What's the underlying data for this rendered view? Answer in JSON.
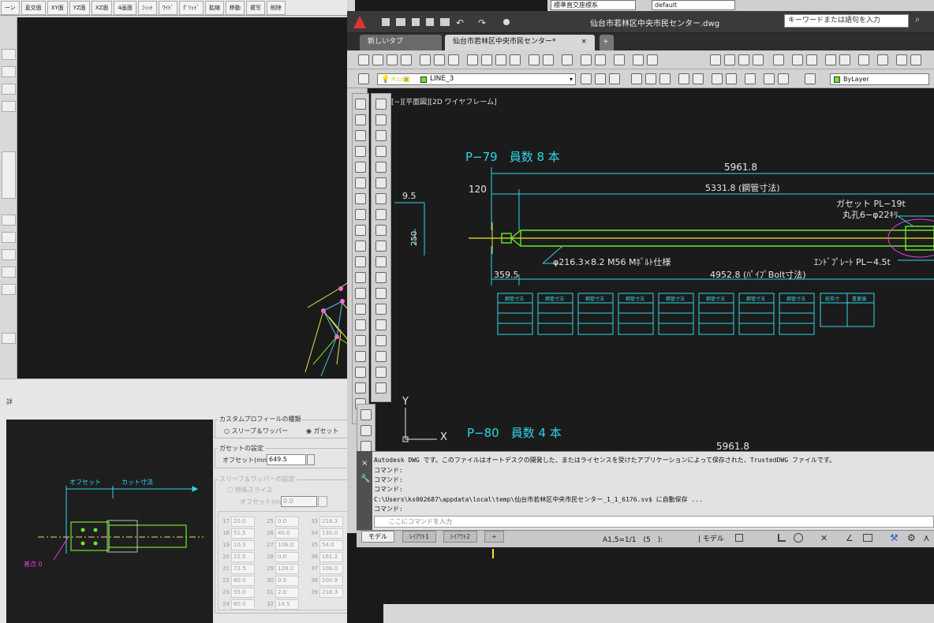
{
  "left_app": {
    "toolbar": [
      "ーン",
      "直交面",
      "XY面",
      "YZ面",
      "XZ面",
      "4画面",
      "ﾌｨｯﾄ",
      "ﾜｲﾄﾞ",
      "ｸﾞﾘｯﾄﾞ",
      "拡縮",
      "移動",
      "複写",
      "削除"
    ]
  },
  "dialog": {
    "title": "詳",
    "profile_group": "カスタムプロフィールの種類",
    "radio_sleeve": "スリーブ＆ワッパー",
    "radio_gusset": "ガセット",
    "gusset_group": "ガセットの設定",
    "offset_label": "オフセット(mm)",
    "offset_value": "649.5",
    "sleeve_group": "スリーブ＆ワッパーの設定",
    "special_slice": "特殊スライス",
    "offset_label2": "オフセット(mm)",
    "offset_value2": "0.0",
    "preview_offset": "オフセット",
    "preview_cut": "カット寸法",
    "preview_base": "基点 0",
    "table": [
      {
        "n": "17",
        "v": "20.0"
      },
      {
        "n": "25",
        "v": "0.0"
      },
      {
        "n": "33",
        "v": "218.3"
      },
      {
        "n": "18",
        "v": "51.5"
      },
      {
        "n": "26",
        "v": "40.0"
      },
      {
        "n": "34",
        "v": "130.0"
      },
      {
        "n": "19",
        "v": "10.3"
      },
      {
        "n": "27",
        "v": "106.0"
      },
      {
        "n": "35",
        "v": "54.0"
      },
      {
        "n": "20",
        "v": "22.0"
      },
      {
        "n": "28",
        "v": "0.0"
      },
      {
        "n": "36",
        "v": "161.2"
      },
      {
        "n": "21",
        "v": "73.5"
      },
      {
        "n": "29",
        "v": "128.0"
      },
      {
        "n": "37",
        "v": "106.0"
      },
      {
        "n": "22",
        "v": "60.0"
      },
      {
        "n": "30",
        "v": "0.5"
      },
      {
        "n": "38",
        "v": "200.9"
      },
      {
        "n": "23",
        "v": "55.0"
      },
      {
        "n": "31",
        "v": "2.0"
      },
      {
        "n": "39",
        "v": "218.3"
      },
      {
        "n": "24",
        "v": "60.0"
      },
      {
        "n": "32",
        "v": "14.5"
      },
      {
        "n": "",
        "v": ""
      }
    ]
  },
  "autocad": {
    "title": "仙台市若林区中央市民センター.dwg",
    "search_placeholder": "キーワードまたは語句を入力",
    "combo_coord": "標準直交座標系",
    "combo_default": "default",
    "tabs": {
      "new_tab": "新しいタブ",
      "doc_tab": "仙台市若林区中央市民センター*",
      "close": "×",
      "plus": "+"
    },
    "layer": "LINE_3",
    "bylayer": "ByLayer",
    "view_label": "[−][平面図][2D ワイヤフレーム]",
    "drawing": {
      "p79": "P−79　員数 8 本",
      "p80": "P−80　員数 4 本",
      "dim_total": "5961.8",
      "dim_total_b": "5961.8",
      "dim_120": "120",
      "dim_5331": "5331.8 (鋼管寸法)",
      "dim_95": "9.5",
      "dim_250": "250",
      "dim_3595": "359.5",
      "dim_4952": "4952.8 (ﾊﾟｲﾌﾟBolt寸法)",
      "pipe_note": "φ216.3×8.2 M56 Mﾎﾞﾙﾄ仕様",
      "gusset_note": "ガセット PL−19t",
      "hole_note": "丸孔6−φ22ｷﾘ",
      "endplate_note": "ｴﾝﾄﾞﾌﾟﾚｰﾄ PL−4.5t",
      "table_header": "鋼管寸法",
      "table_header_last1": "総長寸",
      "table_header_last2": "重量値",
      "axis_y": "Y",
      "axis_x": "X"
    },
    "command": {
      "lines": [
        "Autodesk DWG です。このファイルはオートデスクの開発した、またはライセンスを受けたアプリケーションによって保存された、TrustedDWG ファイルです。",
        "コマンド:",
        "コマンド:",
        "コマンド:",
        "C:\\Users\\ks002687\\appdata\\local\\temp\\仙台市若林区中央市民センター_1_1_6176.sv$ に自動保存 ...",
        "コマンド:"
      ],
      "input_placeholder": "ここにコマンドを入力"
    },
    "layout_tabs": [
      "モデル",
      "ﾚｲｱｳﾄ1",
      "ﾚｲｱｳﾄ2",
      "+"
    ],
    "status": {
      "coords": "A1,5=1/1　(5　):",
      "model": "| モデル"
    }
  },
  "colors": {
    "cyan": "#2fd6e6",
    "green": "#6ee62a",
    "yellow": "#f2e52c",
    "magenta": "#e040e0",
    "white": "#e8e8e8"
  }
}
